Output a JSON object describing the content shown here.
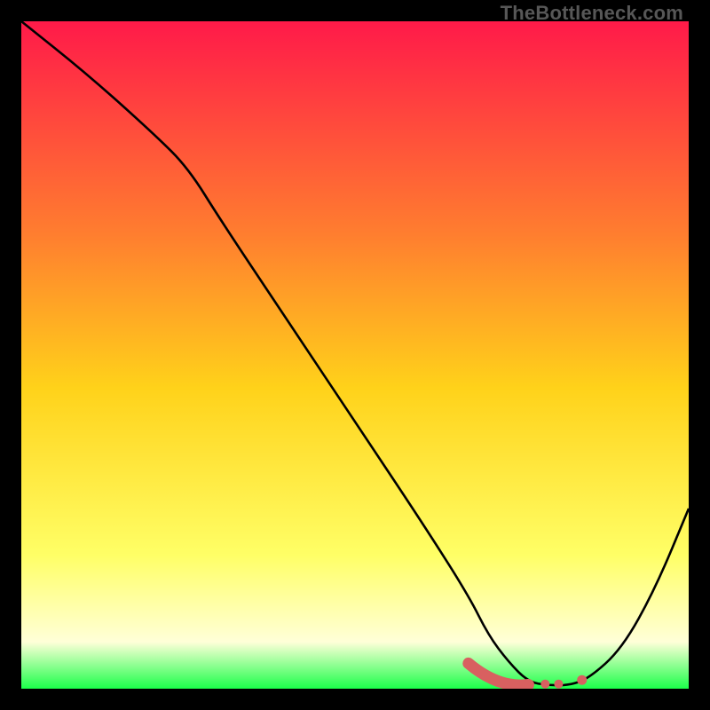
{
  "watermark": "TheBottleneck.com",
  "colors": {
    "gradient_top": "#ff1a49",
    "gradient_mid_upper": "#ff7e2f",
    "gradient_mid": "#ffd21a",
    "gradient_lower": "#ffff66",
    "gradient_pale": "#ffffd8",
    "gradient_bottom": "#1cff4a",
    "curve": "#000000",
    "marker": "#d86060",
    "frame_bg": "#000000"
  },
  "chart_data": {
    "type": "line",
    "title": "",
    "xlabel": "",
    "ylabel": "",
    "xlim": [
      0,
      100
    ],
    "ylim": [
      0,
      100
    ],
    "grid": false,
    "legend": false,
    "series": [
      {
        "name": "bottleneck-curve",
        "x": [
          0,
          10,
          20,
          25,
          30,
          40,
          50,
          60,
          67,
          70,
          73,
          76,
          79,
          82,
          85,
          90,
          95,
          100
        ],
        "values": [
          100,
          92,
          83,
          78,
          70,
          55,
          40,
          25,
          14,
          8,
          4,
          1,
          0.5,
          0.5,
          1.5,
          6,
          15,
          27
        ]
      }
    ],
    "annotations": [
      {
        "name": "marker-segment",
        "x_range": [
          67,
          76
        ],
        "y": 0.8
      },
      {
        "name": "marker-dot-1",
        "x": 78.5,
        "y": 0.7
      },
      {
        "name": "marker-dot-2",
        "x": 80.5,
        "y": 0.7
      },
      {
        "name": "marker-dot-3",
        "x": 84.0,
        "y": 1.3
      }
    ]
  }
}
